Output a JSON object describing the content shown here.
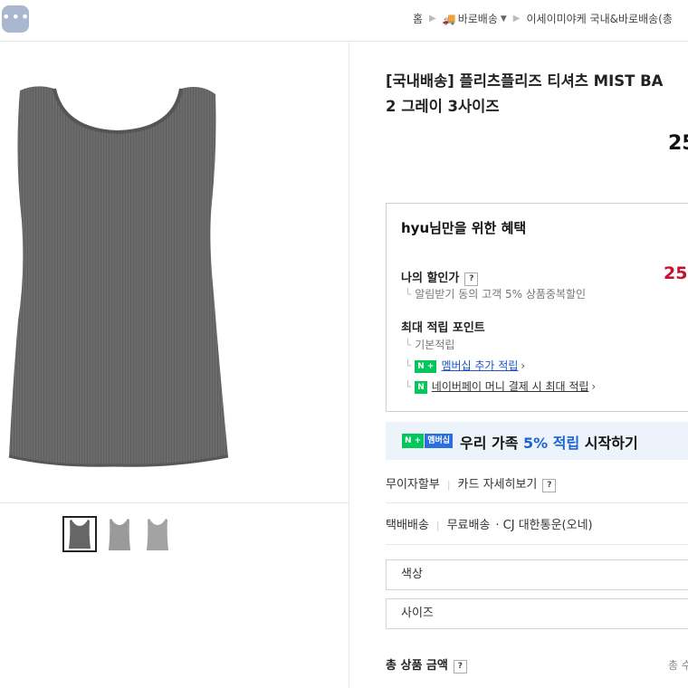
{
  "topbar": {
    "more_glyph": "•••",
    "breadcrumb": {
      "home": "홈",
      "delivery": "바로배송",
      "category": "이세이미야케 국내&바로배송(총"
    }
  },
  "product": {
    "title_line1": "[국내배송] 플리츠플리즈 티셔츠 MIST BA",
    "title_line2": "2 그레이 3사이즈",
    "price_partial": "25",
    "thumbnail_count": 3,
    "selected_thumbnail": 1,
    "color_hex": "#6a6a6a"
  },
  "benefits": {
    "title": "hyu님만을 위한 혜택",
    "my_discount_label": "나의 할인가",
    "help_glyph": "?",
    "my_discount_price_partial": "25",
    "my_discount_note": "알림받기 동의 고객 5% 상품중복할인",
    "max_points_label": "최대 적립 포인트",
    "basic_points": "기본적립",
    "membership_badge": "N +",
    "membership_extra": "멤버십 추가 적립",
    "naverpay_badge": "N",
    "naverpay_max": "네이버페이 머니 결제 시 최대 적립",
    "chevron": "›"
  },
  "family_banner": {
    "badge_n": "N +",
    "badge_m": "멤버십",
    "text_before": "우리 가족 ",
    "text_highlight": "5% 적립",
    "text_after": " 시작하기",
    "accent_color": "#1b63d6"
  },
  "installment": {
    "label": "무이자할부",
    "card_detail": "카드 자세히보기",
    "help_glyph": "?"
  },
  "shipping": {
    "label": "택배배송",
    "fee": "무료배송",
    "carrier": "· CJ 대한통운(오네)"
  },
  "options": {
    "color_placeholder": "색상",
    "size_placeholder": "사이즈"
  },
  "total": {
    "label": "총 상품 금액",
    "help_glyph": "?",
    "right_partial": "총 수"
  },
  "colors": {
    "price_red": "#c8102e",
    "naver_green": "#03c75a",
    "link_blue": "#1a56c4"
  }
}
